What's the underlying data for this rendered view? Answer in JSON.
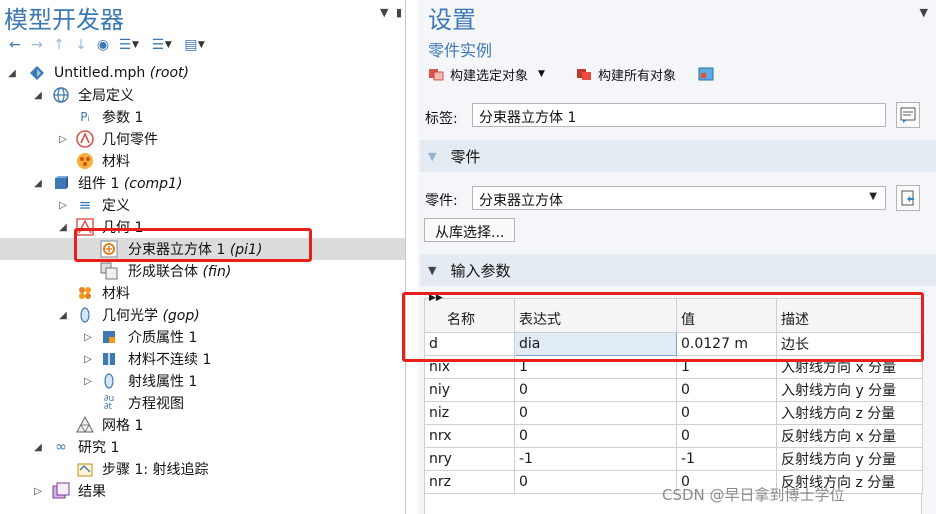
{
  "model_builder": {
    "title": "模型开发器",
    "tree": [
      {
        "label": "Untitled.mph",
        "tag": "(root)",
        "icon": "model-icon"
      },
      {
        "label": "全局定义",
        "tag": "",
        "icon": "globe-icon"
      },
      {
        "label": "参数 1",
        "tag": "",
        "icon": "parameter-icon"
      },
      {
        "label": "几何零件",
        "tag": "",
        "icon": "geometry-parts-icon"
      },
      {
        "label": "材料",
        "tag": "",
        "icon": "materials-icon"
      },
      {
        "label": "组件 1",
        "tag": "(comp1)",
        "icon": "component-icon"
      },
      {
        "label": "定义",
        "tag": "",
        "icon": "definitions-icon"
      },
      {
        "label": "几何 1",
        "tag": "",
        "icon": "geometry-icon"
      },
      {
        "label": "分束器立方体 1",
        "tag": "(pi1)",
        "icon": "part-instance-icon"
      },
      {
        "label": "形成联合体",
        "tag": "(fin)",
        "icon": "form-union-icon"
      },
      {
        "label": "材料",
        "tag": "",
        "icon": "materials-icon"
      },
      {
        "label": "几何光学",
        "tag": "(gop)",
        "icon": "geometrical-optics-icon"
      },
      {
        "label": "介质属性 1",
        "tag": "",
        "icon": "medium-properties-icon"
      },
      {
        "label": "材料不连续 1",
        "tag": "",
        "icon": "material-discontinuity-icon"
      },
      {
        "label": "射线属性 1",
        "tag": "",
        "icon": "ray-properties-icon"
      },
      {
        "label": "方程视图",
        "tag": "",
        "icon": "equation-view-icon"
      },
      {
        "label": "网格 1",
        "tag": "",
        "icon": "mesh-icon"
      },
      {
        "label": "研究 1",
        "tag": "",
        "icon": "study-icon"
      },
      {
        "label": "步骤 1: 射线追踪",
        "tag": "",
        "icon": "study-step-icon"
      },
      {
        "label": "结果",
        "tag": "",
        "icon": "results-icon"
      }
    ]
  },
  "settings": {
    "title": "设置",
    "subtitle": "零件实例",
    "build_selected": "构建选定对象",
    "build_all": "构建所有对象",
    "label_caption": "标签:",
    "label_value": "分束器立方体 1",
    "part_section": "零件",
    "part_caption": "零件:",
    "part_value": "分束器立方体",
    "select_from_library": "从库选择...",
    "input_params_section": "输入参数",
    "table": {
      "headers": [
        "名称",
        "表达式",
        "值",
        "描述"
      ],
      "rows": [
        [
          "d",
          "dia",
          "0.0127 m",
          "边长"
        ],
        [
          "nix",
          "1",
          "1",
          "入射线方向 x 分量"
        ],
        [
          "niy",
          "0",
          "0",
          "入射线方向 y 分量"
        ],
        [
          "niz",
          "0",
          "0",
          "入射线方向 z 分量"
        ],
        [
          "nrx",
          "0",
          "0",
          "反射线方向 x 分量"
        ],
        [
          "nry",
          "-1",
          "-1",
          "反射线方向 y 分量"
        ],
        [
          "nrz",
          "0",
          "0",
          "反射线方向 z 分量"
        ]
      ]
    }
  },
  "watermark": "CSDN @早日拿到博士学位",
  "colors": {
    "accent": "#3c78b4",
    "highlight_box": "#e8201b",
    "selected_row": "#dcdcdc"
  }
}
